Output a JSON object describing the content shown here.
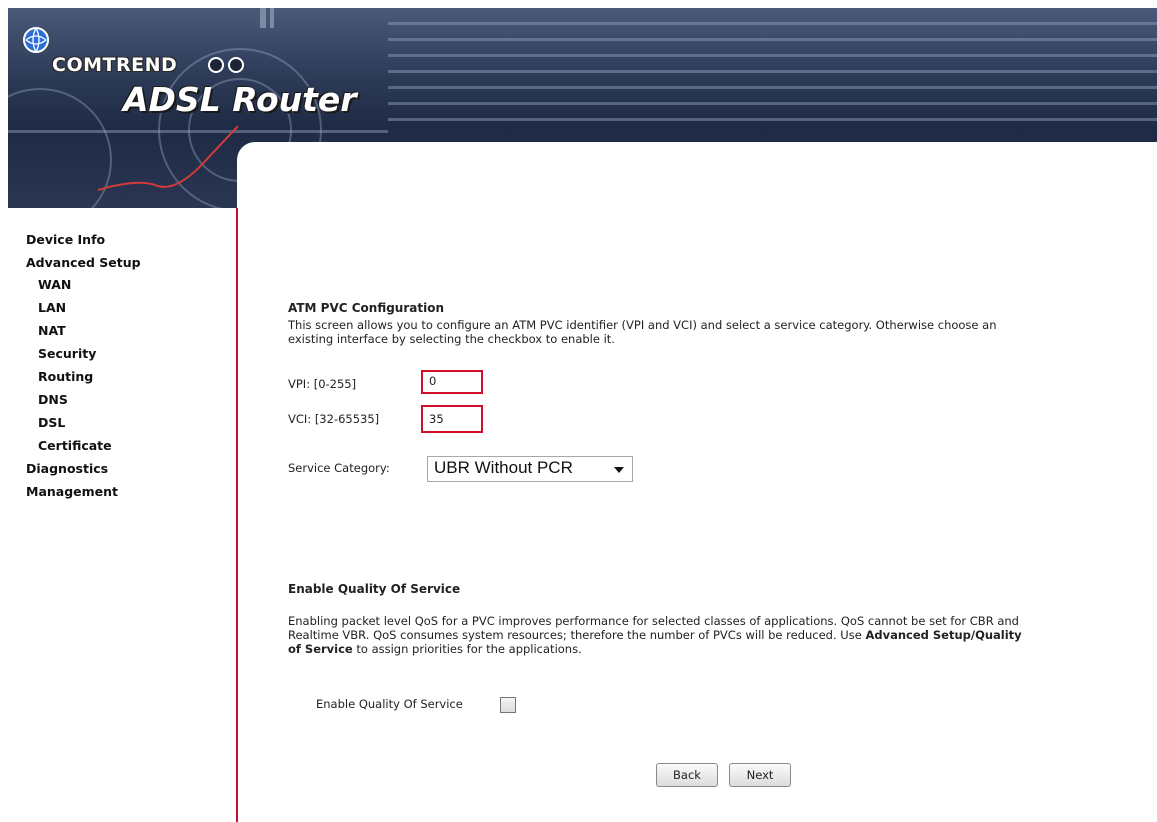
{
  "header": {
    "brand_name": "COMTREND",
    "product_name": "ADSL Router",
    "colors": {
      "banner_dark": "#1f2b45",
      "accent_red": "#c0103a",
      "logo_blue": "#2d6fd8"
    }
  },
  "sidebar": {
    "items": [
      {
        "label": "Device Info"
      },
      {
        "label": "Advanced Setup"
      },
      {
        "label": "WAN"
      },
      {
        "label": "LAN"
      },
      {
        "label": "NAT"
      },
      {
        "label": "Security"
      },
      {
        "label": "Routing"
      },
      {
        "label": "DNS"
      },
      {
        "label": "DSL"
      },
      {
        "label": "Certificate"
      },
      {
        "label": "Diagnostics"
      },
      {
        "label": "Management"
      }
    ]
  },
  "atm": {
    "title": "ATM PVC Configuration",
    "desc_line1": "This screen allows you to configure an ATM PVC identifier (VPI and VCI) and select a service category. Otherwise choose an",
    "desc_line2": "existing interface by selecting the checkbox to enable it.",
    "vpi_label": "VPI: [0-255]",
    "vpi_value": "0",
    "vci_label": "VCI: [32-65535]",
    "vci_value": "35",
    "service_label": "Service Category:",
    "service_value": "UBR Without PCR"
  },
  "qos": {
    "title": "Enable Quality Of Service",
    "desc_line1": "Enabling packet level QoS for a PVC improves performance for selected classes of applications.  QoS cannot be set for CBR and",
    "desc_line2a": "Realtime VBR.  QoS consumes system resources; therefore the number of PVCs will be reduced. Use ",
    "desc_line2b": "Advanced Setup/Quality",
    "desc_line3a": "of Service",
    "desc_line3b": " to assign priorities for the applications.",
    "checkbox_label": "Enable Quality Of Service",
    "checked": false
  },
  "buttons": {
    "back_label": "Back",
    "next_label": "Next"
  }
}
